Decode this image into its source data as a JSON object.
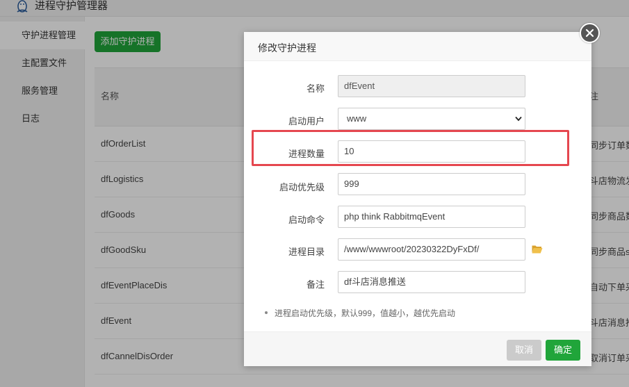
{
  "app": {
    "title": "进程守护管理器"
  },
  "sidebar": {
    "items": [
      {
        "label": "守护进程管理",
        "active": true
      },
      {
        "label": "主配置文件",
        "active": false
      },
      {
        "label": "服务管理",
        "active": false
      },
      {
        "label": "日志",
        "active": false
      }
    ]
  },
  "toolbar": {
    "add_label": "添加守护进程"
  },
  "table": {
    "headers": {
      "name": "名称",
      "note": "注"
    },
    "rows": [
      {
        "name": "dfOrderList",
        "note": "同步订单数"
      },
      {
        "name": "dfLogistics",
        "note": "斗店物流发"
      },
      {
        "name": "dfGoods",
        "note": "同步商品数"
      },
      {
        "name": "dfGoodSku",
        "note": "同步商品sk"
      },
      {
        "name": "dfEventPlaceDis",
        "note": "自动下单采"
      },
      {
        "name": "dfEvent",
        "note": "斗店消息推"
      },
      {
        "name": "dfCannelDisOrder",
        "note": "取消订单采"
      }
    ]
  },
  "modal": {
    "title": "修改守护进程",
    "fields": {
      "name": {
        "label": "名称",
        "value": "dfEvent"
      },
      "user": {
        "label": "启动用户",
        "value": "www"
      },
      "count": {
        "label": "进程数量",
        "value": "10"
      },
      "priority": {
        "label": "启动优先级",
        "value": "999"
      },
      "command": {
        "label": "启动命令",
        "value": "php think RabbitmqEvent"
      },
      "directory": {
        "label": "进程目录",
        "value": "/www/wwwroot/20230322DyFxDf/"
      },
      "remark": {
        "label": "备注",
        "value": "df斗店消息推送"
      }
    },
    "hint": "进程启动优先级，默认999，值越小，越优先启动",
    "cancel_label": "取消",
    "ok_label": "确定"
  },
  "colors": {
    "brand_green": "#20a53a",
    "highlight_red": "#e5474f",
    "folder_yellow": "#e8b33a"
  },
  "icons": {
    "logo": "penguin-icon",
    "close": "close-icon",
    "dropdown": "chevron-down-icon",
    "folder": "folder-icon"
  }
}
